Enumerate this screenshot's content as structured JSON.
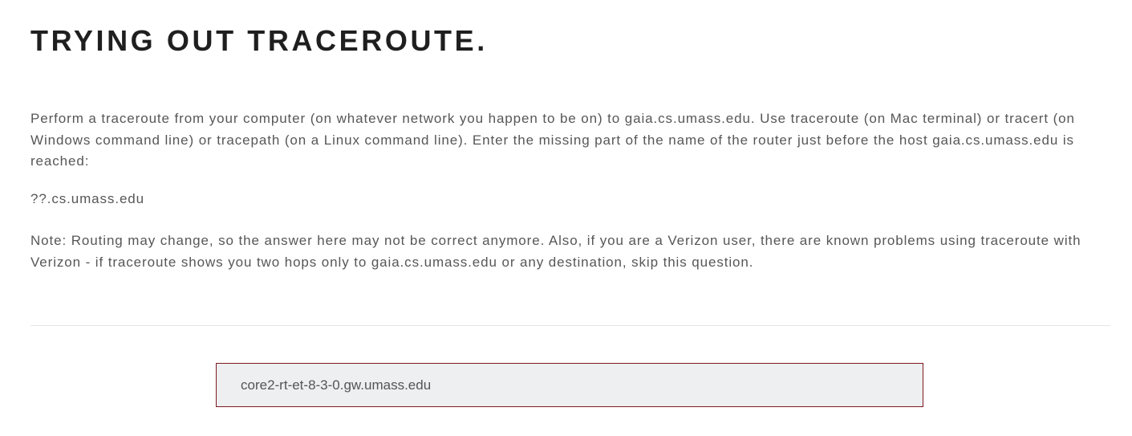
{
  "question": {
    "title": "TRYING OUT TRACEROUTE.",
    "paragraphs": {
      "instructions": "Perform a traceroute from your computer (on whatever network you happen to be on) to gaia.cs.umass.edu. Use traceroute (on Mac terminal) or tracert (on Windows command line) or tracepath (on a Linux command line). Enter the missing part of the name of the router just before the host gaia.cs.umass.edu is reached:",
      "hostname_pattern": "??.cs.umass.edu",
      "note": "Note: Routing may change, so the answer here may not be correct anymore.  Also, if you are a Verizon user, there are known problems using traceroute with Verizon - if traceroute shows you two hops only to gaia.cs.umass.edu or any destination, skip this question."
    }
  },
  "answer": {
    "value": "core2-rt-et-8-3-0.gw.umass.edu"
  },
  "colors": {
    "title": "#1f1f1f",
    "body_text": "#575757",
    "input_border": "#7d1a22",
    "input_background": "#eeeff0",
    "divider": "#e6e6e6"
  }
}
